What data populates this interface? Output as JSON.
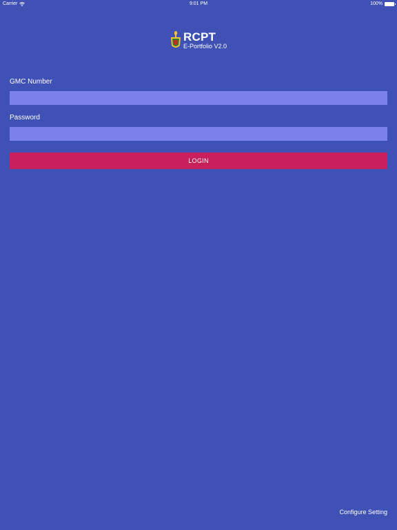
{
  "status_bar": {
    "carrier": "Carrier",
    "time": "9:01 PM",
    "battery": "100%"
  },
  "logo": {
    "title": "RCPT",
    "subtitle": "E-Portfolio V2.0",
    "emblem_icon": "crest-icon"
  },
  "form": {
    "gmc_label": "GMC Number",
    "gmc_value": "",
    "gmc_placeholder": "",
    "password_label": "Password",
    "password_value": "",
    "password_placeholder": "",
    "login_label": "LOGIN"
  },
  "footer": {
    "configure_label": "Configure Setting"
  },
  "colors": {
    "background": "#3f51b5",
    "input": "#7b80eb",
    "button": "#c8205a"
  }
}
